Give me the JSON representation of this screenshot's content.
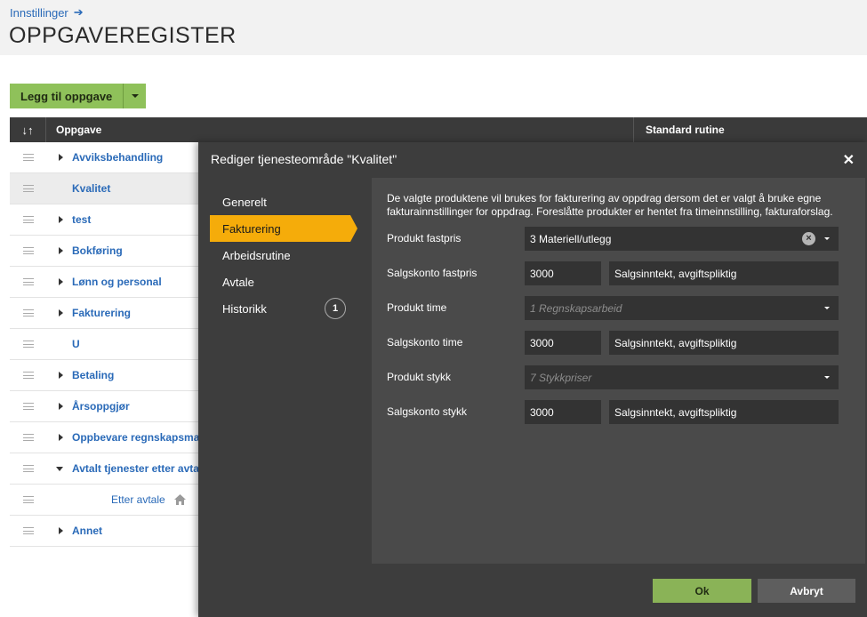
{
  "breadcrumb": {
    "label": "Innstillinger",
    "arrow": "➔"
  },
  "page": {
    "title": "OPPGAVEREGISTER"
  },
  "toolbar": {
    "add_label": "Legg til oppgave"
  },
  "table": {
    "sort_label": "↓↑",
    "columns": {
      "task": "Oppgave",
      "routine": "Standard rutine"
    },
    "rows": [
      {
        "label": "Avviksbehandling",
        "expander": "closed"
      },
      {
        "label": "Kvalitet",
        "expander": "none",
        "selected": true
      },
      {
        "label": "test",
        "expander": "closed"
      },
      {
        "label": "Bokføring",
        "expander": "closed"
      },
      {
        "label": "Lønn og personal",
        "expander": "closed"
      },
      {
        "label": "Fakturering",
        "expander": "closed"
      },
      {
        "label": "U",
        "expander": "none"
      },
      {
        "label": "Betaling",
        "expander": "closed"
      },
      {
        "label": "Årsoppgjør",
        "expander": "closed"
      },
      {
        "label": "Oppbevare regnskapsma",
        "expander": "closed"
      },
      {
        "label": "Avtalt tjenester etter avta",
        "expander": "open"
      },
      {
        "label": "Etter avtale",
        "expander": "none",
        "sub": true,
        "icon": "home-icon"
      },
      {
        "label": "Annet",
        "expander": "closed"
      }
    ]
  },
  "modal": {
    "title": "Rediger tjenesteområde \"Kvalitet\"",
    "close": "✕",
    "nav": {
      "items": [
        {
          "label": "Generelt"
        },
        {
          "label": "Fakturering",
          "active": true
        },
        {
          "label": "Arbeidsrutine"
        },
        {
          "label": "Avtale"
        },
        {
          "label": "Historikk",
          "badge": "1"
        }
      ]
    },
    "description": "De valgte produktene vil brukes for fakturering av oppdrag dersom det er valgt å bruke egne fakturainnstillinger for oppdrag. Foreslåtte produkter er hentet fra timeinnstilling, fakturaforslag.",
    "fields": {
      "product_fixed": {
        "label": "Produkt fastpris",
        "value": "3 Materiell/utlegg"
      },
      "account_fixed": {
        "label": "Salgskonto fastpris",
        "code": "3000",
        "desc": "Salgsinntekt, avgiftspliktig"
      },
      "product_time": {
        "label": "Produkt time",
        "value": "1 Regnskapsarbeid"
      },
      "account_time": {
        "label": "Salgskonto time",
        "code": "3000",
        "desc": "Salgsinntekt, avgiftspliktig"
      },
      "product_piece": {
        "label": "Produkt stykk",
        "value": "7 Stykkpriser"
      },
      "account_piece": {
        "label": "Salgskonto stykk",
        "code": "3000",
        "desc": "Salgsinntekt, avgiftspliktig"
      }
    },
    "buttons": {
      "ok": "Ok",
      "cancel": "Avbryt"
    }
  },
  "colors": {
    "accent": "#f5ac0a",
    "primary_button": "#8fc15a",
    "link": "#2a6ab8",
    "modal_bg": "#3d3d3d"
  }
}
